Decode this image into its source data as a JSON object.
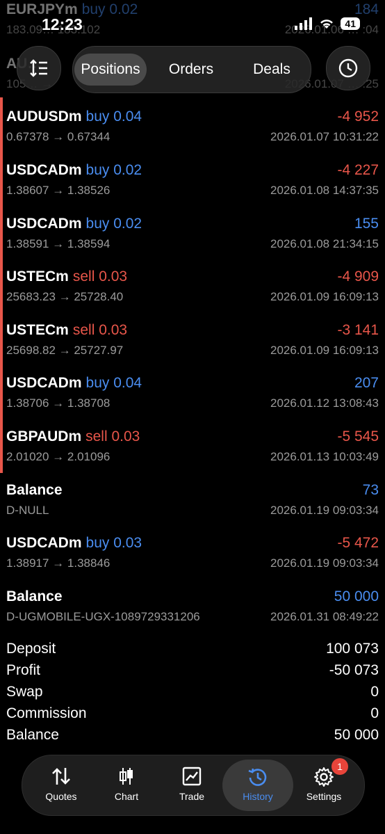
{
  "status": {
    "time": "12:23",
    "battery": "41"
  },
  "tabs": {
    "positions": "Positions",
    "orders": "Orders",
    "deals": "Deals"
  },
  "partial_rows": [
    {
      "symbol": "EURJPYm",
      "side": "buy 0.02",
      "profit": "184",
      "prices": "183.09… 183.102",
      "time": "2026.01.06 … :04"
    },
    {
      "symbol": "AU…",
      "prices": "105… →",
      "time": "2026.01.07 … :25"
    }
  ],
  "rows": [
    {
      "symbol": "AUDUSDm",
      "side": "buy 0.04",
      "profit": "-4 952",
      "prices": "0.67378 → 0.67344",
      "time": "2026.01.07 10:31:22"
    },
    {
      "symbol": "USDCADm",
      "side": "buy 0.02",
      "profit": "-4 227",
      "prices": "1.38607 → 1.38526",
      "time": "2026.01.08 14:37:35"
    },
    {
      "symbol": "USDCADm",
      "side": "buy 0.02",
      "profit": "155",
      "prices": "1.38591 → 1.38594",
      "time": "2026.01.08 21:34:15"
    },
    {
      "symbol": "USTECm",
      "side": "sell 0.03",
      "profit": "-4 909",
      "prices": "25683.23 → 25728.40",
      "time": "2026.01.09 16:09:13"
    },
    {
      "symbol": "USTECm",
      "side": "sell 0.03",
      "profit": "-3 141",
      "prices": "25698.82 → 25727.97",
      "time": "2026.01.09 16:09:13"
    },
    {
      "symbol": "USDCADm",
      "side": "buy 0.04",
      "profit": "207",
      "prices": "1.38706 → 1.38708",
      "time": "2026.01.12 13:08:43"
    },
    {
      "symbol": "GBPAUDm",
      "side": "sell 0.03",
      "profit": "-5 545",
      "prices": "2.01020 → 2.01096",
      "time": "2026.01.13 10:03:49"
    },
    {
      "symbol": "Balance",
      "side": "",
      "profit": "73",
      "prices": "D-NULL",
      "time": "2026.01.19 09:03:34"
    },
    {
      "symbol": "USDCADm",
      "side": "buy 0.03",
      "profit": "-5 472",
      "prices": "1.38917 → 1.38846",
      "time": "2026.01.19 09:03:34"
    },
    {
      "symbol": "Balance",
      "side": "",
      "profit": "50 000",
      "prices": "D-UGMOBILE-UGX-1089729331206",
      "time": "2026.01.31 08:49:22"
    }
  ],
  "summary": [
    {
      "label": "Deposit",
      "value": "100 073"
    },
    {
      "label": "Profit",
      "value": "-50 073"
    },
    {
      "label": "Swap",
      "value": "0"
    },
    {
      "label": "Commission",
      "value": "0"
    },
    {
      "label": "Balance",
      "value": "50 000"
    }
  ],
  "nav": {
    "quotes": "Quotes",
    "chart": "Chart",
    "trade": "Trade",
    "history": "History",
    "settings": "Settings",
    "settings_badge": "1"
  },
  "colors": {
    "buy": "#4a8df0",
    "sell": "#e8564a",
    "background": "#000000"
  }
}
